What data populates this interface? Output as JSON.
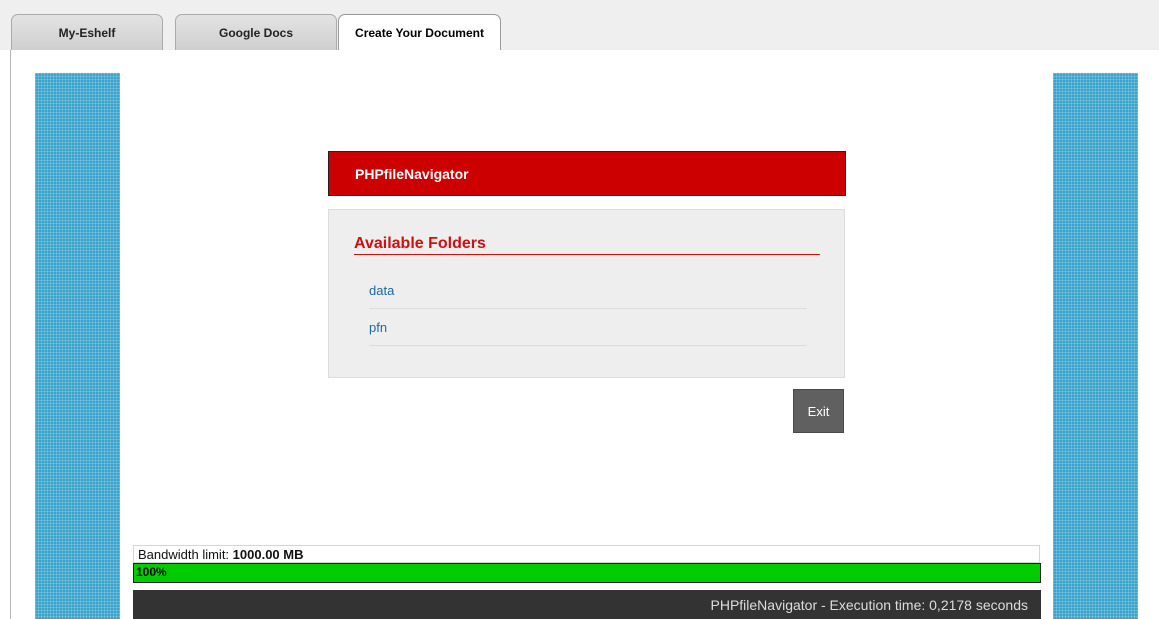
{
  "tabs": [
    {
      "label": "My-Eshelf",
      "active": false
    },
    {
      "label": "Google Docs",
      "active": false
    },
    {
      "label": "Create Your Document",
      "active": true
    }
  ],
  "header": {
    "title": "PHPfileNavigator"
  },
  "folders": {
    "title": "Available Folders",
    "items": [
      "data",
      "pfn"
    ]
  },
  "exit_label": "Exit",
  "bandwidth": {
    "label": "Bandwidth limit:",
    "value": "1000.00 MB",
    "percent_text": "100%",
    "percent": 100
  },
  "footer": {
    "text": "PHPfileNavigator - Execution time: 0,2178 seconds"
  },
  "colors": {
    "header_bg": "#cc0000",
    "side_panels": "#3aa3cc",
    "progress_fill": "#00cc00",
    "footer_bg": "#333333"
  }
}
